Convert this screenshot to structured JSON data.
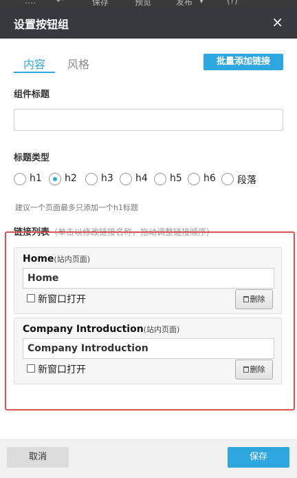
{
  "toolbar": {
    "items": [
      "保存",
      "预览",
      "发布",
      "(?)"
    ]
  },
  "dialog": {
    "title": "设置按钮组",
    "close_symbol": "×",
    "tabs": [
      {
        "label": "内容"
      },
      {
        "label": "风格"
      }
    ],
    "bulk_add_label": "批量添加链接",
    "component_title_label": "组件标题",
    "component_title_value": "",
    "heading_type_label": "标题类型",
    "heading_options": [
      "h1",
      "h2",
      "h3",
      "h4",
      "h5",
      "h6",
      "段落"
    ],
    "heading_selected": "h2",
    "hint": "建议一个页面最多只添加一个h1标题",
    "link_list_label": "链接列表",
    "link_list_sub": "（单击以修改链接名称，拖动调整链接顺序）",
    "links": [
      {
        "name": "Home",
        "type": "(站内页面)",
        "value": "Home",
        "new_window_label": "新窗口打开",
        "new_window": false,
        "delete_label": "删除"
      },
      {
        "name": "Company Introduction",
        "type": "(站内页面)",
        "value": "Company Introduction",
        "new_window_label": "新窗口打开",
        "new_window": false,
        "delete_label": "删除"
      }
    ],
    "cancel_label": "取消",
    "save_label": "保存"
  },
  "colors": {
    "accent": "#2ea7e0",
    "titlebar": "#36393d",
    "highlight": "#d9534f"
  }
}
